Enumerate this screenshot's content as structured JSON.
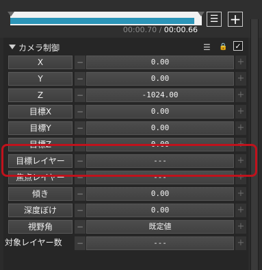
{
  "timeline": {
    "progress": 0.96,
    "current_time": "00:00.70",
    "separator": " / ",
    "total_time": "00:00.66"
  },
  "toolbar": {
    "list_icon": "list-icon",
    "add_icon": "plus-icon"
  },
  "section": {
    "title": "カメラ制御",
    "icons": [
      "list-icon",
      "lock-icon",
      "checkbox-checked-icon"
    ],
    "checked": true
  },
  "rows": [
    {
      "label": "X",
      "value": "0.00"
    },
    {
      "label": "Y",
      "value": "0.00"
    },
    {
      "label": "Z",
      "value": "-1024.00"
    },
    {
      "label": "目標X",
      "value": "0.00"
    },
    {
      "label": "目標Y",
      "value": "0.00"
    },
    {
      "label": "目標Z",
      "value": "0.00"
    },
    {
      "label": "目標レイヤー",
      "value": "---"
    },
    {
      "label": "焦点レイヤー",
      "value": "---"
    },
    {
      "label": "傾き",
      "value": "0.00"
    },
    {
      "label": "深度ぼけ",
      "value": "0.00"
    },
    {
      "label": "視野角",
      "value": "既定値"
    },
    {
      "label": "対象レイヤー数",
      "value": "---"
    }
  ],
  "highlight_color": "#c0121c"
}
